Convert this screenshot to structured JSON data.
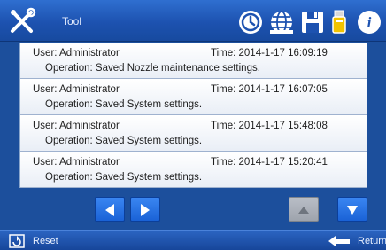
{
  "header": {
    "title": "Tool",
    "icons": [
      "tool-icon",
      "clock-icon",
      "globe-icon",
      "save-icon",
      "usb-icon",
      "info-icon"
    ],
    "accent": "#1d52b0"
  },
  "log": {
    "entries": [
      {
        "user": "User: Administrator",
        "time": "Time: 2014-1-17 16:09:19",
        "operation": "Operation: Saved Nozzle maintenance settings."
      },
      {
        "user": "User: Administrator",
        "time": "Time: 2014-1-17 16:07:05",
        "operation": "Operation: Saved System settings."
      },
      {
        "user": "User: Administrator",
        "time": "Time: 2014-1-17 15:48:08",
        "operation": "Operation: Saved System settings."
      },
      {
        "user": "User: Administrator",
        "time": "Time: 2014-1-17 15:20:41",
        "operation": "Operation: Saved System settings."
      }
    ]
  },
  "navigation": {
    "prev_icon": "left-arrow-icon",
    "next_icon": "right-arrow-icon",
    "up_icon": "up-arrow-icon",
    "down_icon": "down-arrow-icon",
    "button_color": "#1a62d6",
    "disabled_color": "#9ea4ad"
  },
  "footer": {
    "reset_label": "Reset",
    "return_label": "Return"
  }
}
